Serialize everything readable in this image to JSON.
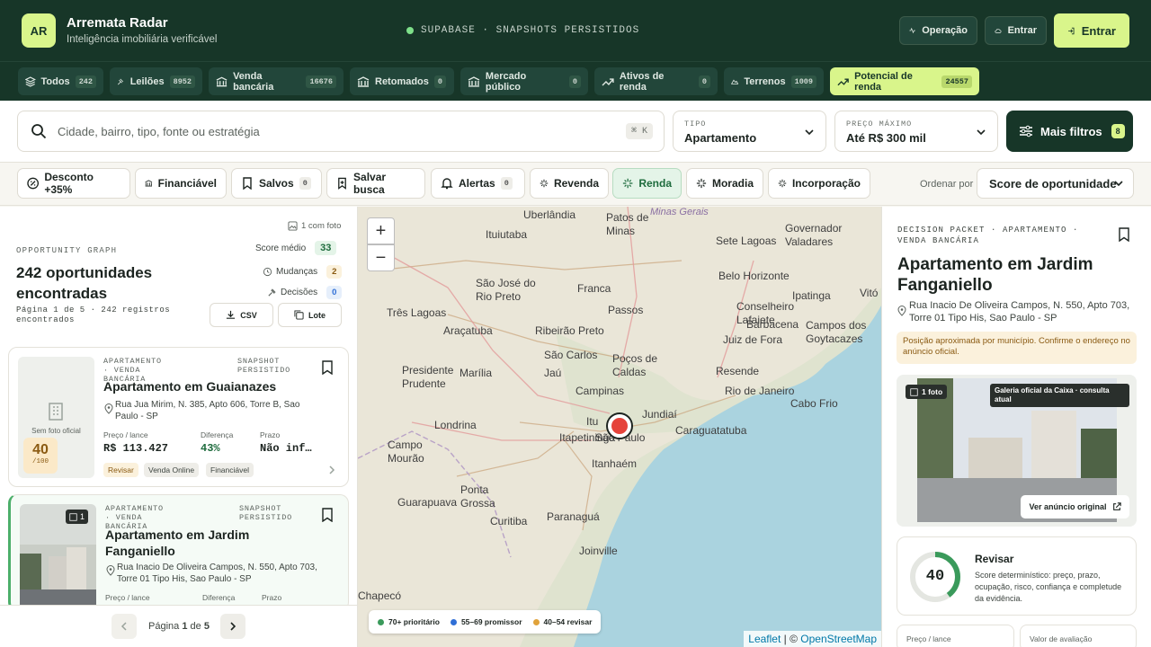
{
  "header": {
    "logo": "AR",
    "brand": "Arremata Radar",
    "tagline": "Inteligência imobiliária verificável",
    "status": "SUPABASE · SNAPSHOTS PERSISTIDOS",
    "btn_operacao": "Operação",
    "btn_entrar_outline": "Entrar",
    "btn_entrar": "Entrar",
    "colors": {
      "bg": "#173628",
      "accent": "#d9f58b"
    }
  },
  "categories": [
    {
      "label": "Todos",
      "count": "242",
      "icon": "layers-icon"
    },
    {
      "label": "Leilões",
      "count": "8952",
      "icon": "gavel-icon"
    },
    {
      "label": "Venda bancária",
      "count": "16676",
      "icon": "bank-icon"
    },
    {
      "label": "Retomados",
      "count": "0",
      "icon": "bank-icon"
    },
    {
      "label": "Mercado público",
      "count": "0",
      "icon": "bank-icon"
    },
    {
      "label": "Ativos de renda",
      "count": "0",
      "icon": "trend-icon"
    },
    {
      "label": "Terrenos",
      "count": "1009",
      "icon": "land-icon"
    },
    {
      "label": "Potencial de renda",
      "count": "24557",
      "icon": "trend-icon",
      "active": true
    }
  ],
  "search": {
    "placeholder": "Cidade, bairro, tipo, fonte ou estratégia",
    "shortcut": "⌘ K",
    "tipo_label": "TIPO",
    "tipo_value": "Apartamento",
    "preco_label": "PREÇO MÁXIMO",
    "preco_value": "Até R$ 300 mil",
    "mais_filtros": "Mais filtros",
    "mais_filtros_count": "8"
  },
  "chips": [
    {
      "label": "Desconto +35%",
      "icon": "percent-icon"
    },
    {
      "label": "Financiável",
      "icon": "bank-icon"
    },
    {
      "label": "Salvos",
      "icon": "bookmark-icon",
      "count": "0"
    },
    {
      "label": "Salvar busca",
      "icon": "bookmark-plus-icon"
    },
    {
      "label": "Alertas",
      "icon": "bell-icon",
      "count": "0"
    },
    {
      "label": "Revenda",
      "icon": "sparkle-icon"
    },
    {
      "label": "Renda",
      "icon": "sparkle-icon",
      "active": true
    },
    {
      "label": "Moradia",
      "icon": "sparkle-icon"
    },
    {
      "label": "Incorporação",
      "icon": "sparkle-icon"
    }
  ],
  "sort": {
    "label": "Ordenar por",
    "value": "Score de oportunidade"
  },
  "list": {
    "section_label": "OPPORTUNITY GRAPH",
    "heading": "242 oportunidades encontradas",
    "pagination_info": "Página 1 de 5 · 242 registros encontrados",
    "com_foto": "1 com foto",
    "score_medio_label": "Score médio",
    "score_medio": "33",
    "mudancas_label": "Mudanças",
    "mudancas": "2",
    "decisoes_label": "Decisões",
    "decisoes": "0",
    "csv": "CSV",
    "lote": "Lote",
    "cards": [
      {
        "type": "APARTAMENTO · VENDA BANCÁRIA",
        "snapshot": "SNAPSHOT PERSISTIDO",
        "title": "Apartamento em Guaianazes",
        "address": "Rua Jua Mirim, N. 385, Apto 606, Torre B, Sao Paulo - SP",
        "no_photo": "Sem foto oficial",
        "score": "40",
        "score_max": "/100",
        "preco_label": "Preço / lance",
        "preco": "R$ 113.427",
        "diferenca_label": "Diferença",
        "diferenca": "43%",
        "prazo_label": "Prazo",
        "prazo": "Não inf…",
        "tags": [
          "Revisar",
          "Venda Online",
          "Financiável"
        ]
      },
      {
        "type": "APARTAMENTO · VENDA BANCÁRIA",
        "snapshot": "SNAPSHOT PERSISTIDO",
        "title": "Apartamento em Jardim Fanganiello",
        "address": "Rua Inacio De Oliveira Campos, N. 550, Apto 703, Torre 01 Tipo His, Sao Paulo - SP",
        "photo_count": "1",
        "preco_label": "Preço / lance",
        "diferenca_label": "Diferença",
        "prazo_label": "Prazo"
      }
    ],
    "pager": {
      "prefix": "Página",
      "current": "1",
      "sep": "de",
      "total": "5"
    }
  },
  "map": {
    "cities": [
      "Uberlândia",
      "Patos de Minas",
      "Minas Gerais",
      "Governador Valadares",
      "Ituiutaba",
      "Sete Lagoas",
      "Belo Horizonte",
      "São José do Rio Preto",
      "Franca",
      "Ipatinga",
      "Vitó",
      "Três Lagoas",
      "Passos",
      "Conselheiro Lafaiete",
      "Araçatuba",
      "Ribeirão Preto",
      "Barbacena",
      "Juiz de Fora",
      "Campos dos Goytacazes",
      "São Carlos",
      "Poços de Caldas",
      "Presidente Prudente",
      "Marília",
      "Jaú",
      "Resende",
      "Campinas",
      "Rio de Janeiro",
      "Cabo Frio",
      "Jundiaí",
      "Itu",
      "Londrina",
      "Itapetininga",
      "São Paulo",
      "Caraguatatuba",
      "Campo Mourão",
      "Itanhaém",
      "Ponta Grossa",
      "Guarapuava",
      "Curitiba",
      "Paranaguá",
      "Joinville",
      "Chapecó"
    ],
    "zoom_in": "+",
    "zoom_out": "−",
    "legend": [
      {
        "label": "70+ prioritário",
        "color": "#3a9a5b"
      },
      {
        "label": "55–69 promissor",
        "color": "#2f6fd6"
      },
      {
        "label": "40–54 revisar",
        "color": "#e0a23a"
      }
    ],
    "attribution_leaflet": "Leaflet",
    "attribution_sep": "| ©",
    "attribution_osm": "OpenStreetMap"
  },
  "detail": {
    "packet_label": "DECISION PACKET · APARTAMENTO · VENDA BANCÁRIA",
    "title": "Apartamento em Jardim Fanganiello",
    "address": "Rua Inacio De Oliveira Campos, N. 550, Apto 703, Torre 01 Tipo His, Sao Paulo - SP",
    "warning": "Posição aproximada por município. Confirme o endereço no anúncio oficial.",
    "photo_count": "1 foto",
    "gallery_label": "Galeria oficial da Caixa · consulta atual",
    "ver_anuncio": "Ver anúncio original",
    "score": "40",
    "score_fraction": 0.4,
    "verdict": "Revisar",
    "verdict_desc": "Score determinístico: preço, prazo, ocupação, risco, confiança e completude da evidência.",
    "preco_label": "Preço / lance",
    "avaliacao_label": "Valor de avaliação"
  }
}
